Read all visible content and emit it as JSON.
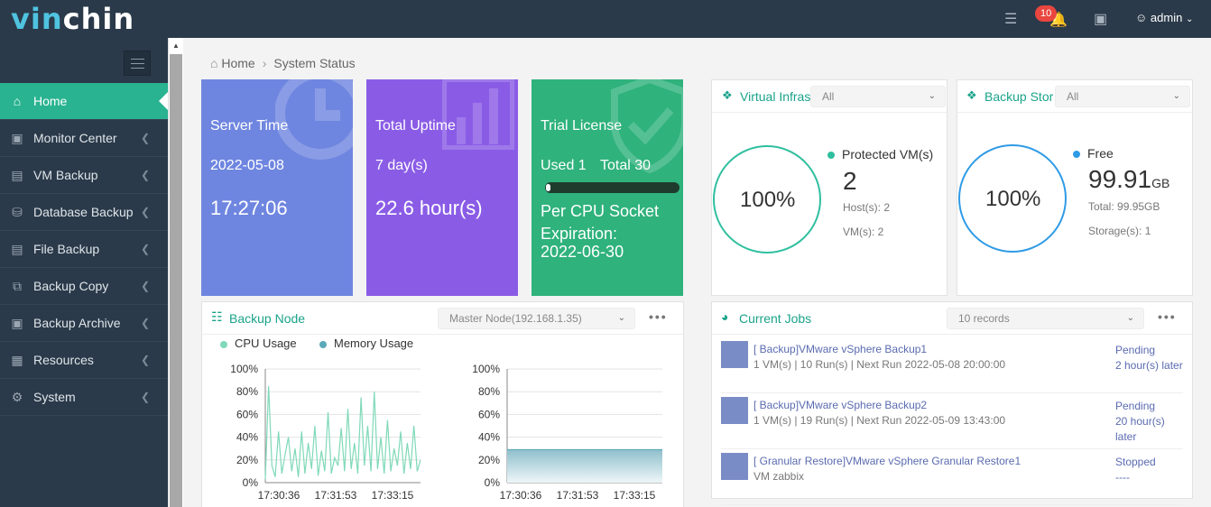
{
  "topbar": {
    "logo_a": "vin",
    "logo_b": "chin",
    "notif_count": "10",
    "user": "admin"
  },
  "sidebar": {
    "items": [
      {
        "label": "Home",
        "icon": "home-icon"
      },
      {
        "label": "Monitor Center",
        "icon": "monitor-icon"
      },
      {
        "label": "VM Backup",
        "icon": "vm-icon"
      },
      {
        "label": "Database Backup",
        "icon": "database-icon"
      },
      {
        "label": "File Backup",
        "icon": "file-icon"
      },
      {
        "label": "Backup Copy",
        "icon": "copy-icon"
      },
      {
        "label": "Backup Archive",
        "icon": "archive-icon"
      },
      {
        "label": "Resources",
        "icon": "resources-icon"
      },
      {
        "label": "System",
        "icon": "gear-icon"
      }
    ]
  },
  "breadcrumb": {
    "home": "Home",
    "current": "System Status"
  },
  "cards": {
    "server": {
      "label": "Server Time",
      "date": "2022-05-08",
      "time": "17:27:06",
      "color": "#6f86e0"
    },
    "uptime": {
      "label": "Total Uptime",
      "days": "7 day(s)",
      "hours": "22.6 hour(s)",
      "color": "#8a5ce6"
    },
    "license": {
      "label": "Trial License",
      "used": "Used 1",
      "total": "Total 30",
      "used_fraction": 0.033,
      "type": "Per CPU Socket",
      "expiration_label": "Expiration:",
      "expiration": "2022-06-30",
      "color": "#2fb27c"
    }
  },
  "virtual": {
    "title": "Virtual Infras",
    "filter": "All",
    "percent": "100%",
    "legend": "Protected VM(s)",
    "value": "2",
    "hosts": "Host(s): 2",
    "vms": "VM(s): 2",
    "color": "#2fbf9f"
  },
  "storage": {
    "title": "Backup Stor",
    "filter": "All",
    "percent": "100%",
    "legend": "Free",
    "value": "99.91",
    "unit": "GB",
    "total": "Total: 99.95GB",
    "storages": "Storage(s): 1",
    "color": "#2f9be6"
  },
  "backup_node": {
    "title": "Backup Node",
    "node": "Master Node(192.168.1.35)",
    "legend_cpu": "CPU Usage",
    "legend_mem": "Memory Usage",
    "cpu_color": "#7fd9b8",
    "mem_color": "#5aa9b8"
  },
  "chart_data": [
    {
      "type": "line",
      "series": [
        {
          "name": "CPU Usage",
          "values": [
            3,
            85,
            15,
            5,
            45,
            8,
            25,
            40,
            10,
            30,
            5,
            45,
            8,
            35,
            12,
            50,
            6,
            28,
            10,
            62,
            8,
            22,
            15,
            48,
            10,
            65,
            12,
            35,
            8,
            75,
            15,
            50,
            10,
            80,
            12,
            40,
            8,
            55,
            10,
            30,
            15,
            45,
            8,
            35,
            12,
            50,
            10,
            20
          ]
        }
      ],
      "x_ticks": [
        "17:30:36",
        "17:31:53",
        "17:33:15"
      ],
      "y_ticks": [
        "100%",
        "80%",
        "60%",
        "40%",
        "20%",
        "0%"
      ],
      "ylim": [
        0,
        100
      ]
    },
    {
      "type": "area",
      "series": [
        {
          "name": "Memory Usage",
          "values": [
            29,
            29,
            29,
            29,
            29,
            29,
            29,
            29,
            29,
            29,
            29,
            29
          ]
        }
      ],
      "x_ticks": [
        "17:30:36",
        "17:31:53",
        "17:33:15"
      ],
      "y_ticks": [
        "100%",
        "80%",
        "60%",
        "40%",
        "20%",
        "0%"
      ],
      "ylim": [
        0,
        100
      ]
    }
  ],
  "current_jobs": {
    "title": "Current Jobs",
    "records": "10 records",
    "jobs": [
      {
        "name": "[ Backup]VMware vSphere Backup1",
        "sub": "1 VM(s) | 10 Run(s) | Next Run 2022-05-08 20:00:00",
        "status": "Pending",
        "next": "2 hour(s) later"
      },
      {
        "name": "[ Backup]VMware vSphere Backup2",
        "sub": "1 VM(s) | 19 Run(s) | Next Run 2022-05-09 13:43:00",
        "status": "Pending",
        "next": "20 hour(s) later"
      },
      {
        "name": "[ Granular Restore]VMware vSphere Granular Restore1",
        "sub": "VM zabbix",
        "status": "Stopped",
        "next": "----"
      }
    ]
  }
}
